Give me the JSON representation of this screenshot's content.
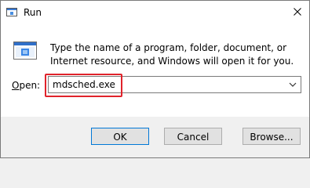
{
  "window": {
    "title": "Run",
    "icon": "run-program-icon",
    "close_icon": "close-icon"
  },
  "dialog": {
    "description": "Type the name of a program, folder, document, or Internet resource, and Windows will open it for you.",
    "open_label_accel": "O",
    "open_label_rest": "pen:",
    "input_value": "mdsched.exe",
    "dropdown_icon": "chevron-down-icon"
  },
  "buttons": {
    "ok": "OK",
    "cancel": "Cancel",
    "browse": "Browse..."
  },
  "colors": {
    "highlight": "#e0232b",
    "default_button_border": "#0078d7",
    "footer_background": "#f0f0f0"
  }
}
